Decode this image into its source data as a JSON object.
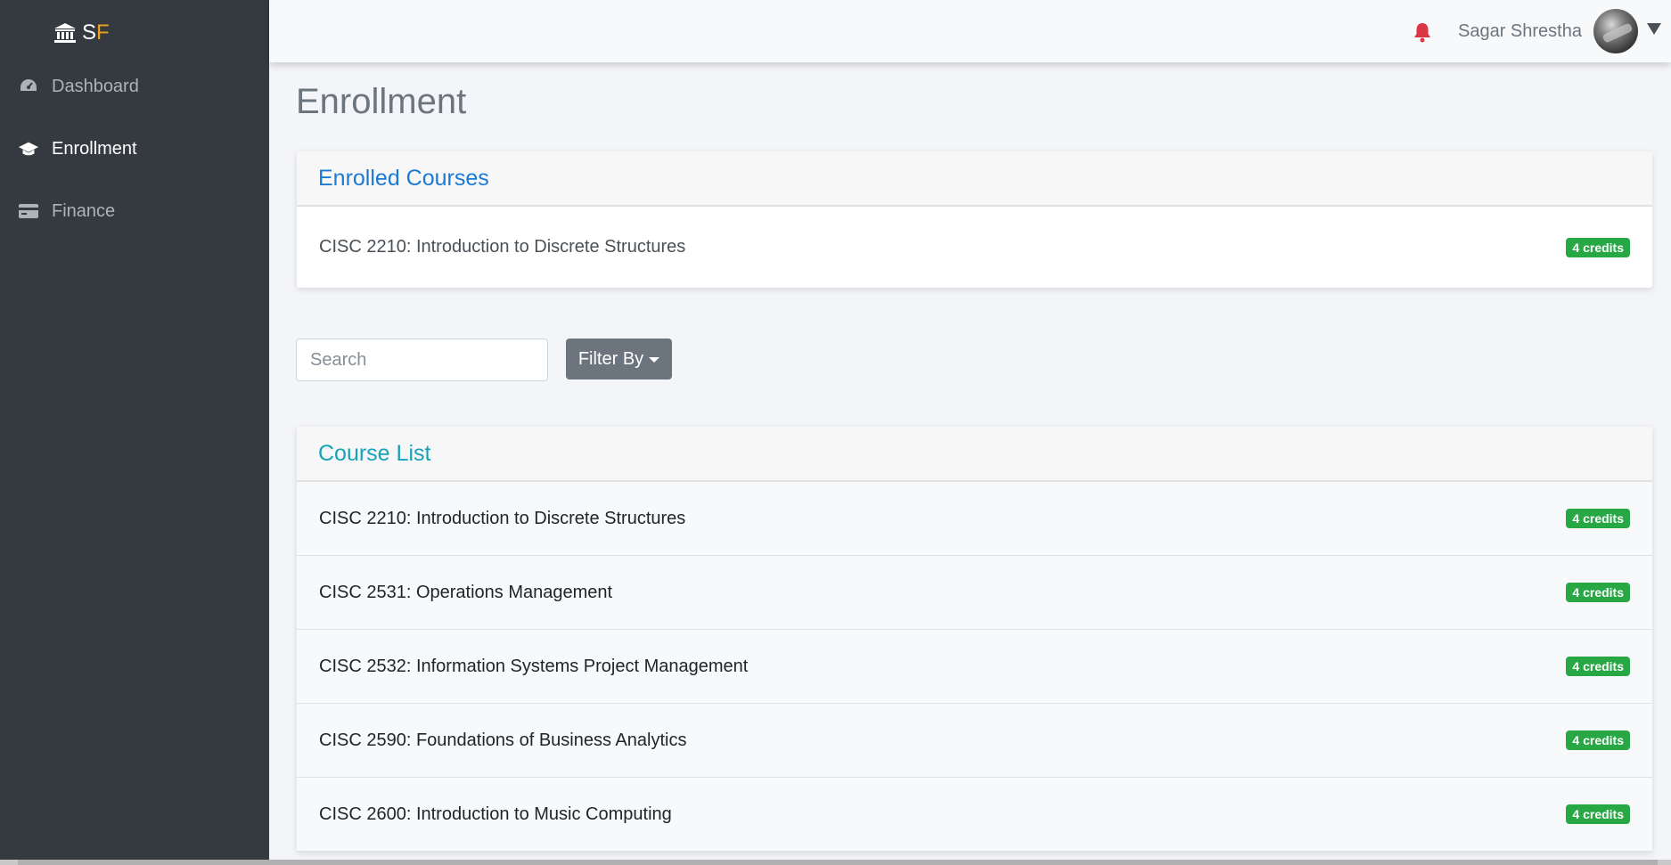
{
  "brand": {
    "initial_s": "S",
    "initial_f": "F"
  },
  "sidebar": {
    "items": [
      {
        "label": "Dashboard",
        "icon": "tachometer-icon"
      },
      {
        "label": "Enrollment",
        "icon": "graduation-cap-icon",
        "active": true
      },
      {
        "label": "Finance",
        "icon": "credit-card-icon"
      }
    ]
  },
  "header": {
    "user_name": "Sagar Shrestha",
    "bell_color": "#dc3545"
  },
  "page": {
    "title": "Enrollment"
  },
  "enrolled": {
    "title": "Enrolled Courses",
    "courses": [
      {
        "name": "CISC 2210: Introduction to Discrete Structures",
        "credits": "4 credits"
      }
    ]
  },
  "search": {
    "placeholder": "Search",
    "value": ""
  },
  "filter": {
    "label": "Filter By"
  },
  "course_list": {
    "title": "Course List",
    "courses": [
      {
        "name": "CISC 2210: Introduction to Discrete Structures",
        "credits": "4 credits"
      },
      {
        "name": "CISC 2531: Operations Management",
        "credits": "4 credits"
      },
      {
        "name": "CISC 2532: Information Systems Project Management",
        "credits": "4 credits"
      },
      {
        "name": "CISC 2590: Foundations of Business Analytics",
        "credits": "4 credits"
      },
      {
        "name": "CISC 2600: Introduction to Music Computing",
        "credits": "4 credits"
      }
    ]
  },
  "colors": {
    "accent": "#1a7ad4",
    "success": "#28a745",
    "sidebar": "#343a40"
  }
}
